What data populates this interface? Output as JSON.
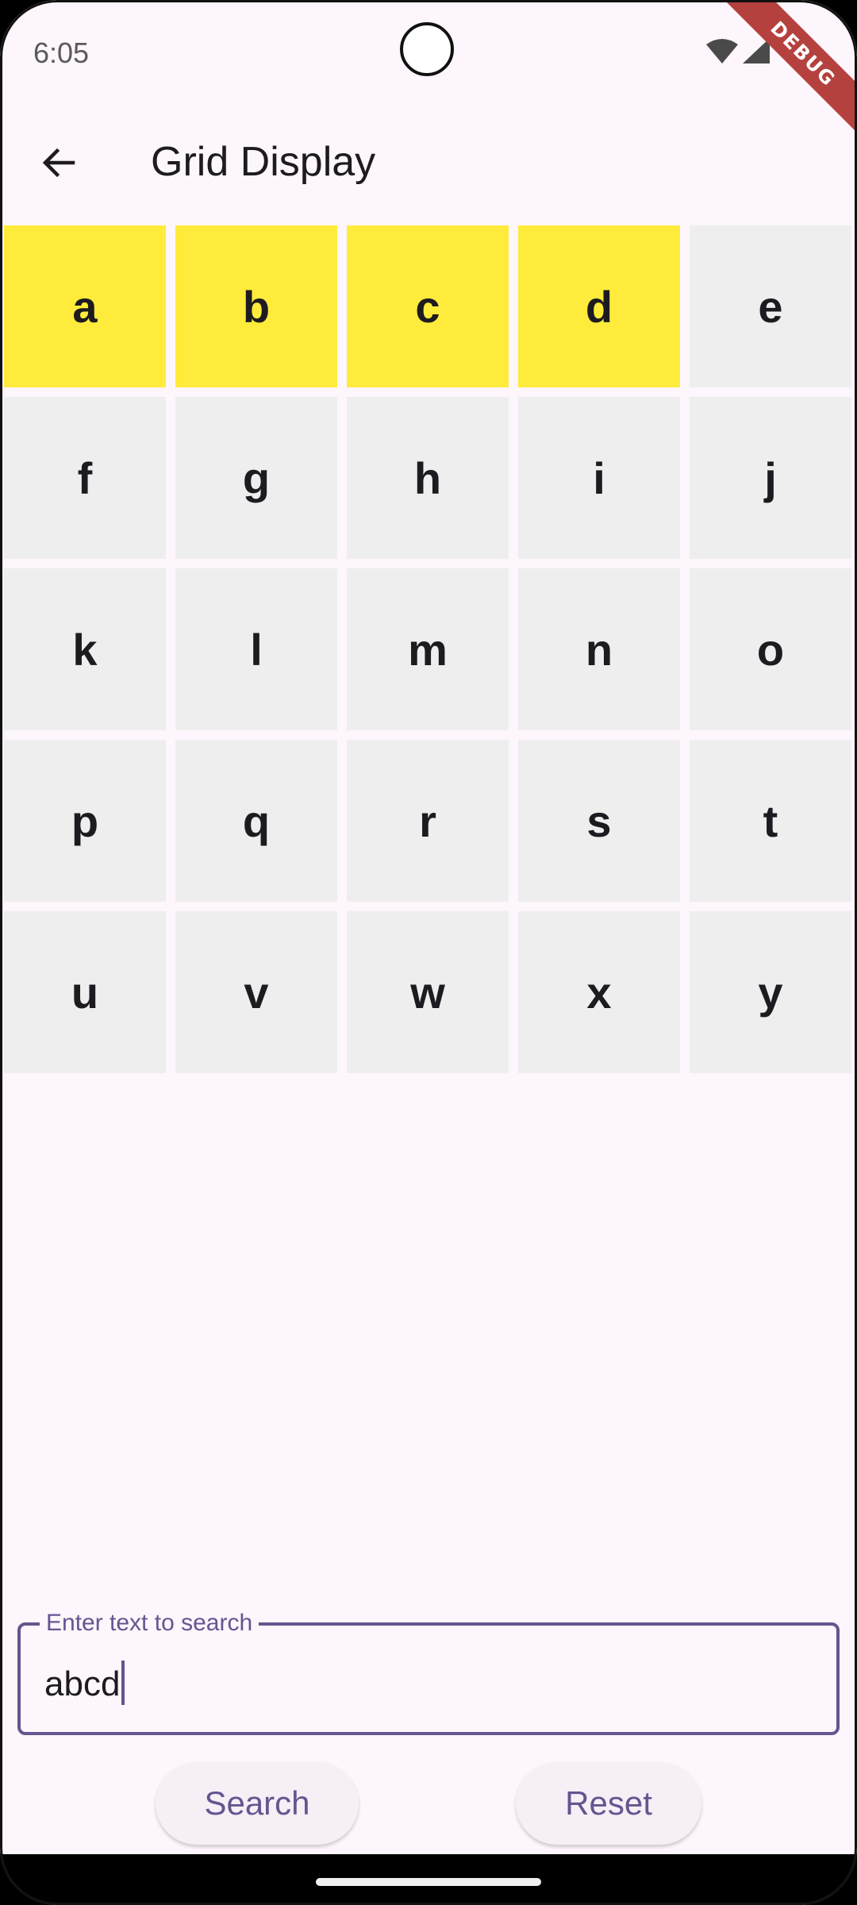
{
  "status_bar": {
    "time": "6:05",
    "debug_label": "DEBUG"
  },
  "app_bar": {
    "title": "Grid Display",
    "back_icon": "arrow-back-icon"
  },
  "grid": {
    "cells": [
      {
        "letter": "a",
        "highlighted": true
      },
      {
        "letter": "b",
        "highlighted": true
      },
      {
        "letter": "c",
        "highlighted": true
      },
      {
        "letter": "d",
        "highlighted": true
      },
      {
        "letter": "e",
        "highlighted": false
      },
      {
        "letter": "f",
        "highlighted": false
      },
      {
        "letter": "g",
        "highlighted": false
      },
      {
        "letter": "h",
        "highlighted": false
      },
      {
        "letter": "i",
        "highlighted": false
      },
      {
        "letter": "j",
        "highlighted": false
      },
      {
        "letter": "k",
        "highlighted": false
      },
      {
        "letter": "l",
        "highlighted": false
      },
      {
        "letter": "m",
        "highlighted": false
      },
      {
        "letter": "n",
        "highlighted": false
      },
      {
        "letter": "o",
        "highlighted": false
      },
      {
        "letter": "p",
        "highlighted": false
      },
      {
        "letter": "q",
        "highlighted": false
      },
      {
        "letter": "r",
        "highlighted": false
      },
      {
        "letter": "s",
        "highlighted": false
      },
      {
        "letter": "t",
        "highlighted": false
      },
      {
        "letter": "u",
        "highlighted": false
      },
      {
        "letter": "v",
        "highlighted": false
      },
      {
        "letter": "w",
        "highlighted": false
      },
      {
        "letter": "x",
        "highlighted": false
      },
      {
        "letter": "y",
        "highlighted": false
      }
    ]
  },
  "search": {
    "label": "Enter text to search",
    "value": "abcd"
  },
  "buttons": {
    "search_label": "Search",
    "reset_label": "Reset"
  },
  "colors": {
    "background": "#fdf6fc",
    "highlight": "#ffeb3b",
    "cell": "#eeeeee",
    "accent": "#65558f",
    "debug_banner": "#b5413e"
  }
}
